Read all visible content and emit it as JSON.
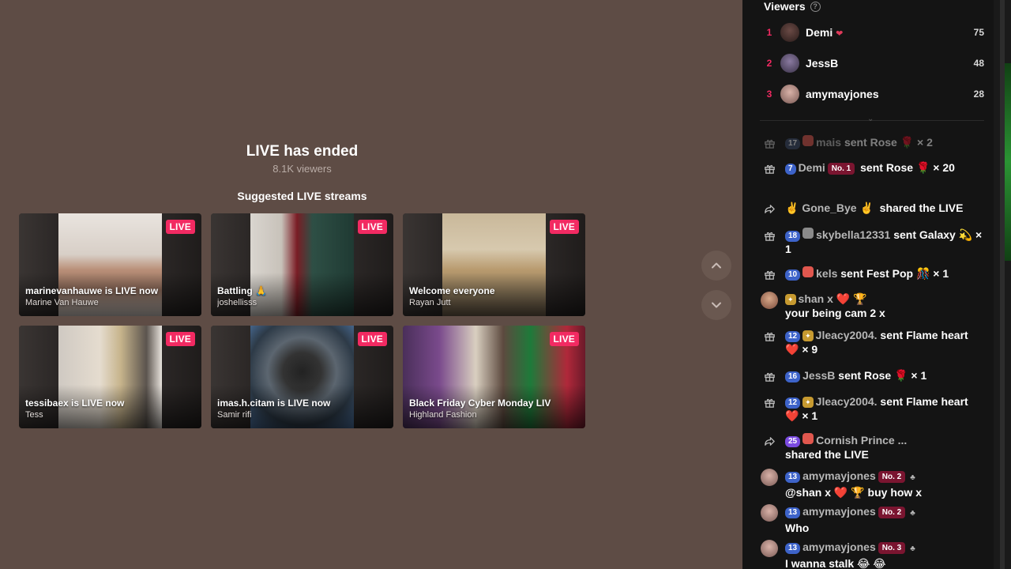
{
  "ended": {
    "title": "LIVE has ended",
    "viewers": "8.1K viewers",
    "suggested": "Suggested LIVE streams"
  },
  "cards": [
    {
      "badge": "LIVE",
      "title": "marinevanhauwe is LIVE now",
      "host": "Marine Van Hauwe"
    },
    {
      "badge": "LIVE",
      "title": "Battling 🙏",
      "host": "joshellisss"
    },
    {
      "badge": "LIVE",
      "title": "Welcome everyone",
      "host": "Rayan Jutt"
    },
    {
      "badge": "LIVE",
      "title": "tessibaex is LIVE now",
      "host": "Tess"
    },
    {
      "badge": "LIVE",
      "title": "imas.h.citam is LIVE now",
      "host": "Samir rifi"
    },
    {
      "badge": "LIVE",
      "title": "Black Friday Cyber Monday LIV",
      "host": "Highland Fashion"
    }
  ],
  "viewers": {
    "title": "Viewers",
    "help": "?",
    "list": [
      {
        "rank": "1",
        "name": "Demi",
        "count": "75"
      },
      {
        "rank": "2",
        "name": "JessB",
        "count": "48"
      },
      {
        "rank": "3",
        "name": "amymayjones",
        "count": "28"
      }
    ]
  },
  "chat": [
    {
      "level": "17",
      "user": "mais",
      "text": "sent Rose 🌹 × 2"
    },
    {
      "level": "7",
      "user": "Demi",
      "rank_badge": "No. 1",
      "text": "sent Rose 🌹 × 20"
    },
    {
      "user": "✌️ Gone_Bye ✌️",
      "text": "shared the LIVE"
    },
    {
      "level": "18",
      "user": "skybella12331",
      "text": "sent Galaxy 💫 × 1"
    },
    {
      "level": "10",
      "user": "kels",
      "text": "sent Fest Pop 🎊 × 1"
    },
    {
      "user": "shan x ❤️ 🏆",
      "text": "your being cam 2 x"
    },
    {
      "level": "12",
      "user": "Jleacy2004.",
      "text": "sent Flame heart ❤️ × 9"
    },
    {
      "level": "16",
      "user": "JessB",
      "text": "sent Rose 🌹 × 1"
    },
    {
      "level": "12",
      "user": "Jleacy2004.",
      "text": "sent Flame heart ❤️ × 1"
    },
    {
      "level": "25",
      "user": "Cornish Prince ...",
      "text": "shared the LIVE"
    },
    {
      "level": "13",
      "user": "amymayjones",
      "rank_badge": "No. 2",
      "text": "@shan x ❤️ 🏆 buy how x"
    },
    {
      "level": "13",
      "user": "amymayjones",
      "rank_badge": "No. 2",
      "text": "Who"
    },
    {
      "level": "13",
      "user": "amymayjones",
      "rank_badge": "No. 3",
      "text": "I wanna stalk 😂 😂"
    }
  ],
  "colors": {
    "accent": "#f22a62",
    "background": "#5e4c45",
    "panel": "#141414"
  }
}
